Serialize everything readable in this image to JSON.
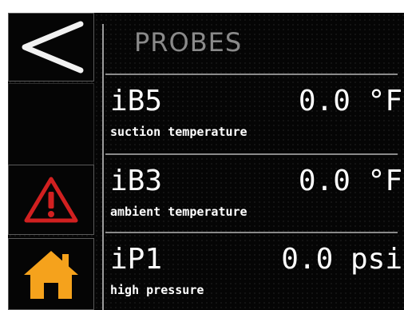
{
  "header": {
    "title": "PROBES"
  },
  "icons": {
    "back": "chevron-left-icon",
    "alarm": "warning-triangle-icon",
    "home": "home-icon"
  },
  "colors": {
    "alarm": "#d12020",
    "home": "#f5a21c"
  },
  "probes": [
    {
      "id": "iB5",
      "value": "0.0",
      "unit": "°F",
      "description": "suction temperature"
    },
    {
      "id": "iB3",
      "value": "0.0",
      "unit": "°F",
      "description": "ambient temperature"
    },
    {
      "id": "iP1",
      "value": "0.0",
      "unit": "psi",
      "description": "high pressure"
    }
  ]
}
